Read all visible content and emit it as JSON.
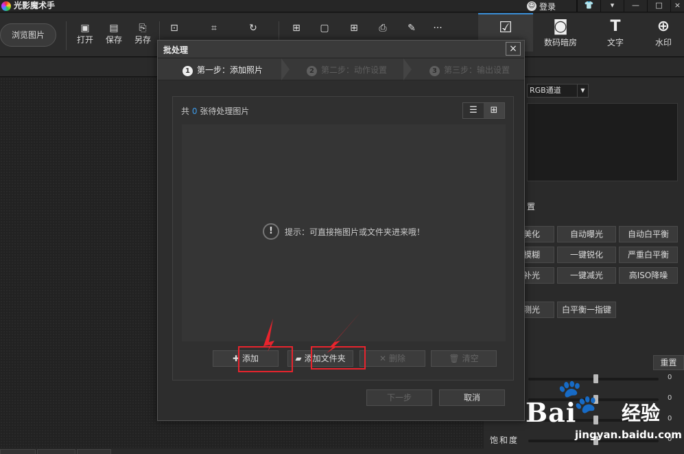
{
  "app": {
    "title": "光影魔术手",
    "login": "登录"
  },
  "toolbar": {
    "browse": "浏览图片",
    "tools": [
      {
        "label": "打开",
        "icon": "open-image-icon"
      },
      {
        "label": "保存",
        "icon": "save-icon"
      },
      {
        "label": "另存",
        "icon": "save-as-icon"
      },
      {
        "label": "",
        "icon": "size-icon"
      },
      {
        "label": "",
        "icon": "crop-icon"
      },
      {
        "label": "",
        "icon": "rotate-icon"
      },
      {
        "label": "",
        "icon": "frame-icon"
      },
      {
        "label": "",
        "icon": "stamp-icon"
      },
      {
        "label": "",
        "icon": "collage-icon"
      },
      {
        "label": "",
        "icon": "print-icon"
      },
      {
        "label": "",
        "icon": "brush-icon"
      },
      {
        "label": "",
        "icon": "more-icon"
      }
    ],
    "right_tabs": [
      {
        "label": "",
        "icon": "edit-icon"
      },
      {
        "label": "数码暗房",
        "icon": "camera-icon"
      },
      {
        "label": "文字",
        "icon": "text-icon"
      },
      {
        "label": "水印",
        "icon": "watermark-icon"
      }
    ]
  },
  "right_panel": {
    "channel": "RGB通道",
    "section_title": "置",
    "fx_buttons": [
      [
        "美化",
        "自动曝光",
        "自动白平衡"
      ],
      [
        "模糊",
        "一键锐化",
        "严重白平衡"
      ],
      [
        "补光",
        "一键减光",
        "高ISO降噪"
      ],
      [
        "测光",
        "白平衡一指键"
      ]
    ],
    "reset": "重置",
    "sliders": [
      {
        "label": "",
        "value": "0"
      },
      {
        "label": "",
        "value": "0"
      },
      {
        "label": "",
        "value": "0"
      },
      {
        "label": "饱和度",
        "value": "0"
      }
    ]
  },
  "dialog": {
    "title": "批处理",
    "close": "×",
    "steps": [
      {
        "num": "1",
        "label": "第一步：添加照片",
        "active": true
      },
      {
        "num": "2",
        "label": "第二步：动作设置",
        "active": false
      },
      {
        "num": "3",
        "label": "第三步：输出设置",
        "active": false
      }
    ],
    "count_prefix": "共",
    "count_value": "0",
    "count_suffix": "张待处理图片",
    "hint": "提示：可直接拖图片或文件夹进来哦！",
    "buttons": {
      "add": "添加",
      "add_folder": "添加文件夹",
      "delete": "删除",
      "clear": "清空"
    },
    "next": "下一步",
    "cancel": "取消"
  },
  "watermark": {
    "brand": "Bai",
    "brand2": "经验",
    "url": "jingyan.baidu.com"
  },
  "colors": {
    "accent": "#3d9be9",
    "highlight": "#e8242d"
  }
}
